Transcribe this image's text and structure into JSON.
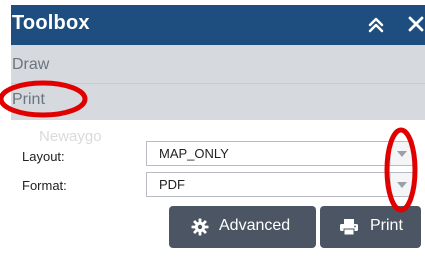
{
  "toolbox": {
    "title": "Toolbox",
    "menu": [
      {
        "label": "Draw"
      },
      {
        "label": "Print"
      }
    ]
  },
  "print_form": {
    "ghost_text": "Newaygo",
    "layout": {
      "label": "Layout:",
      "value": "MAP_ONLY"
    },
    "format": {
      "label": "Format:",
      "value": "PDF"
    },
    "buttons": {
      "advanced": "Advanced",
      "print": "Print"
    }
  },
  "colors": {
    "header": "#1e4e80",
    "menu_bg": "#d6d9dd",
    "button": "#4b5563",
    "annotation": "#e00000"
  },
  "icons": {
    "collapse": "double-chevron-up-icon",
    "close": "close-icon",
    "gear": "gear-icon",
    "printer": "printer-icon",
    "dropdown": "chevron-down-icon"
  }
}
